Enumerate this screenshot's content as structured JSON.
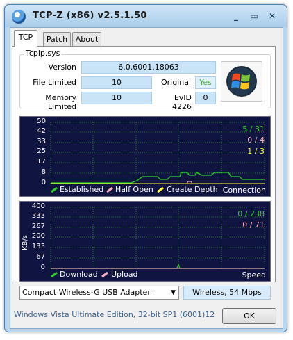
{
  "window": {
    "title": "TCP-Z  (x86)  v2.5.1.50",
    "minimize": "_",
    "maximize": "▭",
    "close": "✕"
  },
  "tabs": [
    {
      "label": "TCP"
    },
    {
      "label": "Patch"
    },
    {
      "label": "About"
    }
  ],
  "tcpip": {
    "group_title": "Tcpip.sys",
    "version_label": "Version",
    "version_value": "6.0.6001.18063",
    "file_limited_label": "File Limited",
    "file_limited_value": "10",
    "original_label": "Original",
    "original_value": "Yes",
    "memory_limited_label": "Memory Limited",
    "memory_limited_value": "10",
    "evid_label": "EvID 4226",
    "evid_value": "0"
  },
  "connection_graph": {
    "y_ticks": [
      "50",
      "42",
      "33",
      "25",
      "17",
      "8",
      "0"
    ],
    "legend": {
      "established": "Established",
      "half_open": "Half Open",
      "create_depth": "Create Depth",
      "title": "Connection"
    },
    "counters": {
      "established": "5 / 31",
      "half_open": "0 / 4",
      "create_depth": "1 / 3"
    },
    "colors": {
      "established": "#2bd12b",
      "half_open": "#ffb0c0",
      "create_depth": "#ffff33",
      "grid": "#2d7a2d"
    }
  },
  "speed_graph": {
    "y_ticks": [
      "400",
      "333",
      "267",
      "200",
      "133",
      "67",
      "0"
    ],
    "unit": "KB/s",
    "legend": {
      "download": "Download",
      "upload": "Upload",
      "title": "Speed"
    },
    "counters": {
      "download": "0 / 238",
      "upload": "0 / 71"
    },
    "colors": {
      "download": "#2bd12b",
      "upload": "#ffb0c0"
    }
  },
  "adapter": {
    "selected": "Compact Wireless-G USB Adapter",
    "status": "Wireless,  54 Mbps"
  },
  "footer": {
    "os_text": "Windows Vista Ultimate Edition, 32-bit SP1 (6001)12",
    "ok_label": "OK"
  }
}
